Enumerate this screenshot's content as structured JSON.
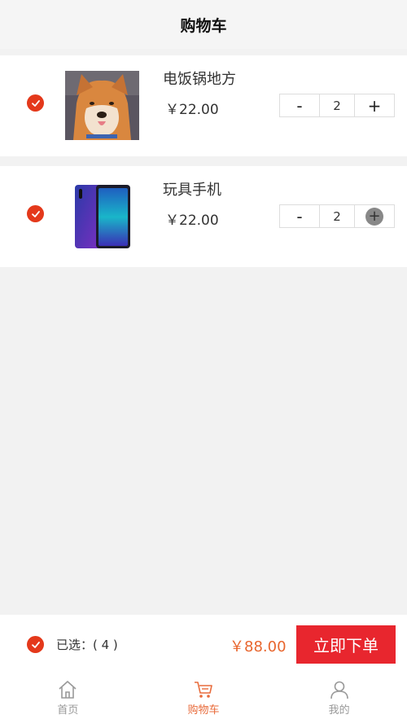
{
  "header": {
    "title": "购物车"
  },
  "cart": {
    "items": [
      {
        "name": "电饭锅地方",
        "price": "￥22.00",
        "quantity": "2",
        "image": "shiba-dog-photo",
        "checked": true
      },
      {
        "name": "玩具手机",
        "price": "￥22.00",
        "quantity": "2",
        "image": "phone-photo",
        "checked": true
      }
    ],
    "stepper": {
      "minus": "-",
      "plus": "+"
    }
  },
  "footer": {
    "selected_label": "已选：( 4 )",
    "total": "￥88.00",
    "order_button": "立即下单"
  },
  "tabbar": {
    "tabs": [
      {
        "label": "首页",
        "icon": "home-icon"
      },
      {
        "label": "购物车",
        "icon": "cart-icon",
        "active": true
      },
      {
        "label": "我的",
        "icon": "user-icon"
      }
    ]
  },
  "colors": {
    "accent": "#e4391b",
    "order_button": "#e8262e",
    "total": "#e8662e",
    "active_tab": "#e86b3b"
  }
}
